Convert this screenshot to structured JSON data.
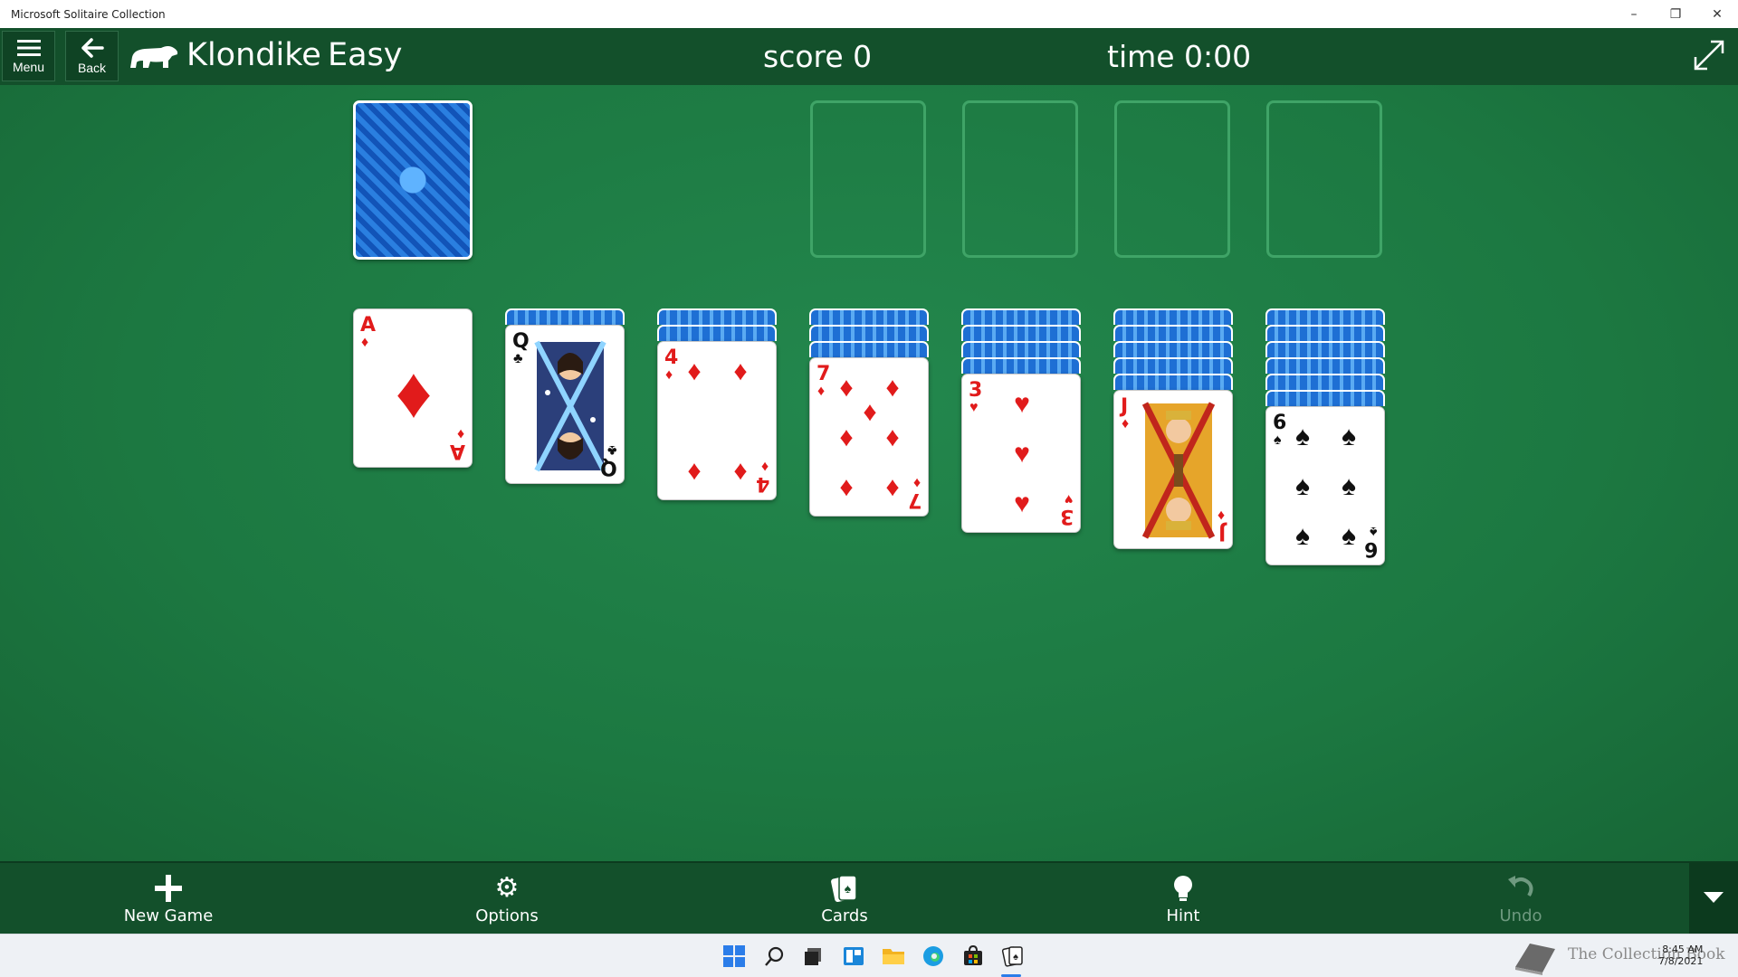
{
  "window": {
    "title": "Microsoft Solitaire Collection",
    "minimize": "–",
    "restore": "❐",
    "close": "✕"
  },
  "header": {
    "menu_label": "Menu",
    "back_label": "Back",
    "game_name": "Klondike",
    "difficulty": "Easy",
    "score_text": "score  0",
    "time_text": "time  0:00"
  },
  "board": {
    "stock": {
      "face_down": true
    },
    "foundations": [
      {
        "empty": true
      },
      {
        "empty": true
      },
      {
        "empty": true
      },
      {
        "empty": true
      }
    ],
    "tableau": [
      {
        "hidden": 0,
        "top": {
          "rank": "A",
          "suit": "♦",
          "color": "red"
        }
      },
      {
        "hidden": 1,
        "top": {
          "rank": "Q",
          "suit": "♣",
          "color": "black"
        }
      },
      {
        "hidden": 2,
        "top": {
          "rank": "4",
          "suit": "♦",
          "color": "red"
        }
      },
      {
        "hidden": 3,
        "top": {
          "rank": "7",
          "suit": "♦",
          "color": "red"
        }
      },
      {
        "hidden": 4,
        "top": {
          "rank": "3",
          "suit": "♥",
          "color": "red"
        }
      },
      {
        "hidden": 5,
        "top": {
          "rank": "J",
          "suit": "♦",
          "color": "red"
        }
      },
      {
        "hidden": 6,
        "top": {
          "rank": "6",
          "suit": "♠",
          "color": "black"
        }
      }
    ]
  },
  "toolbar": {
    "new_game_label": "New Game",
    "options_label": "Options",
    "cards_label": "Cards",
    "hint_label": "Hint",
    "undo_label": "Undo"
  },
  "taskbar": {
    "time": "8:45 AM",
    "date": "7/8/2021",
    "watermark": "The Collection Book"
  },
  "colors": {
    "felt": "#1e7a44",
    "bar": "#13502b",
    "card_red": "#e11b1b",
    "card_back": "#1560c9"
  }
}
